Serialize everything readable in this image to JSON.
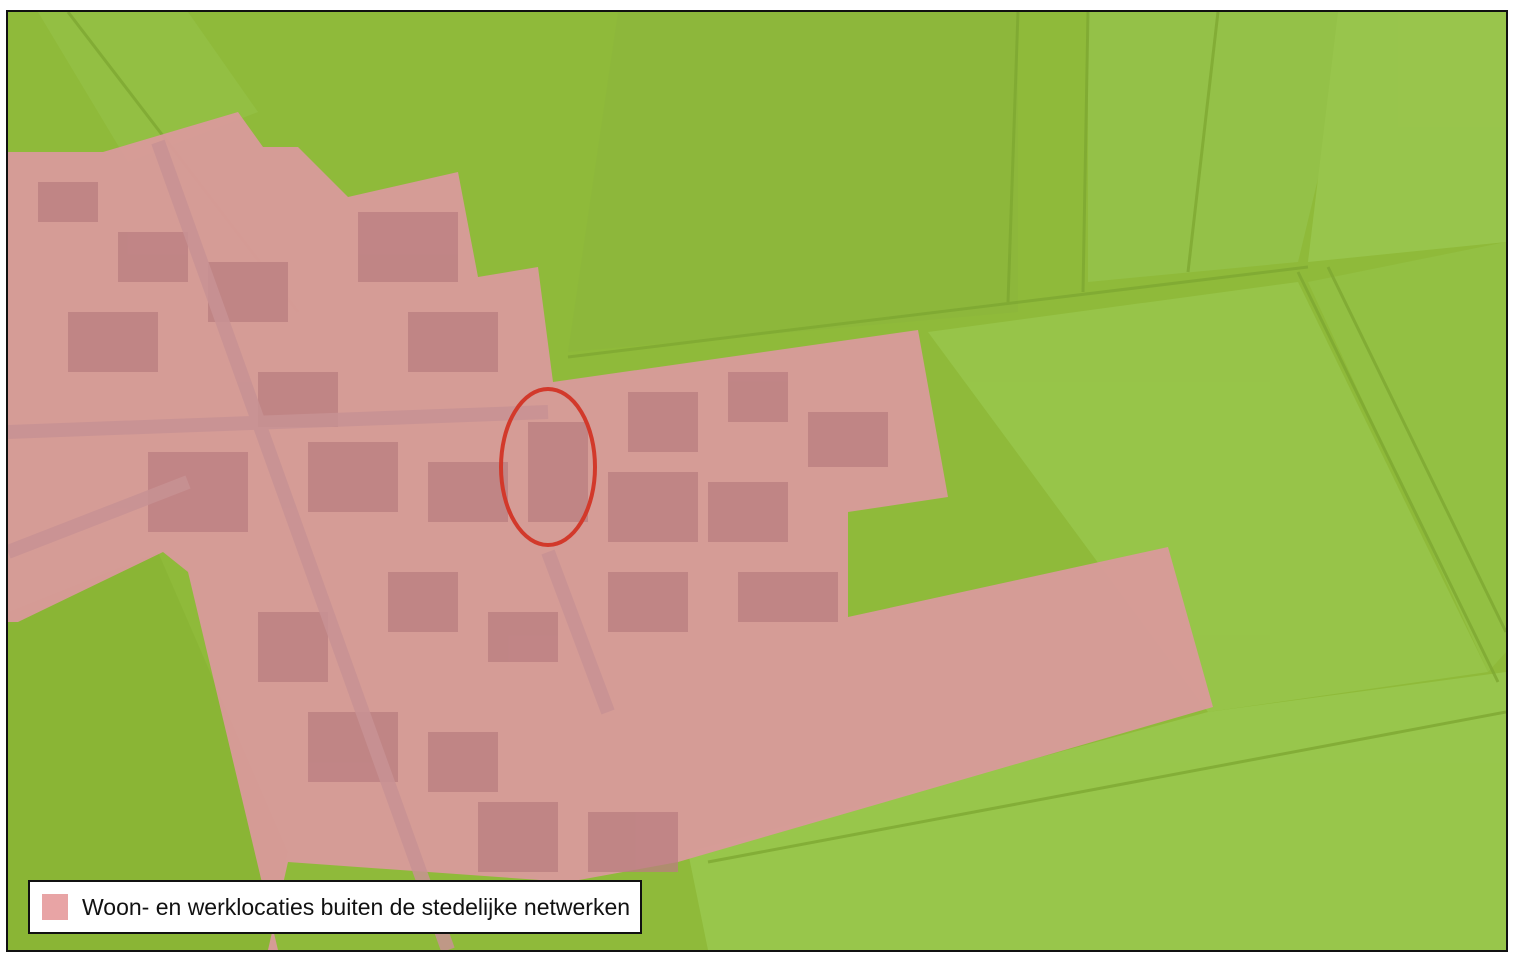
{
  "map": {
    "base_color": "#8fba3a",
    "overlay_color": "#d99a9b",
    "marker_color": "#d2392b",
    "marker_shape": "ellipse-outline"
  },
  "legend": {
    "items": [
      {
        "label": "Woon- en werklocaties buiten de stedelijke netwerken",
        "color": "#e8a4a5"
      }
    ]
  }
}
